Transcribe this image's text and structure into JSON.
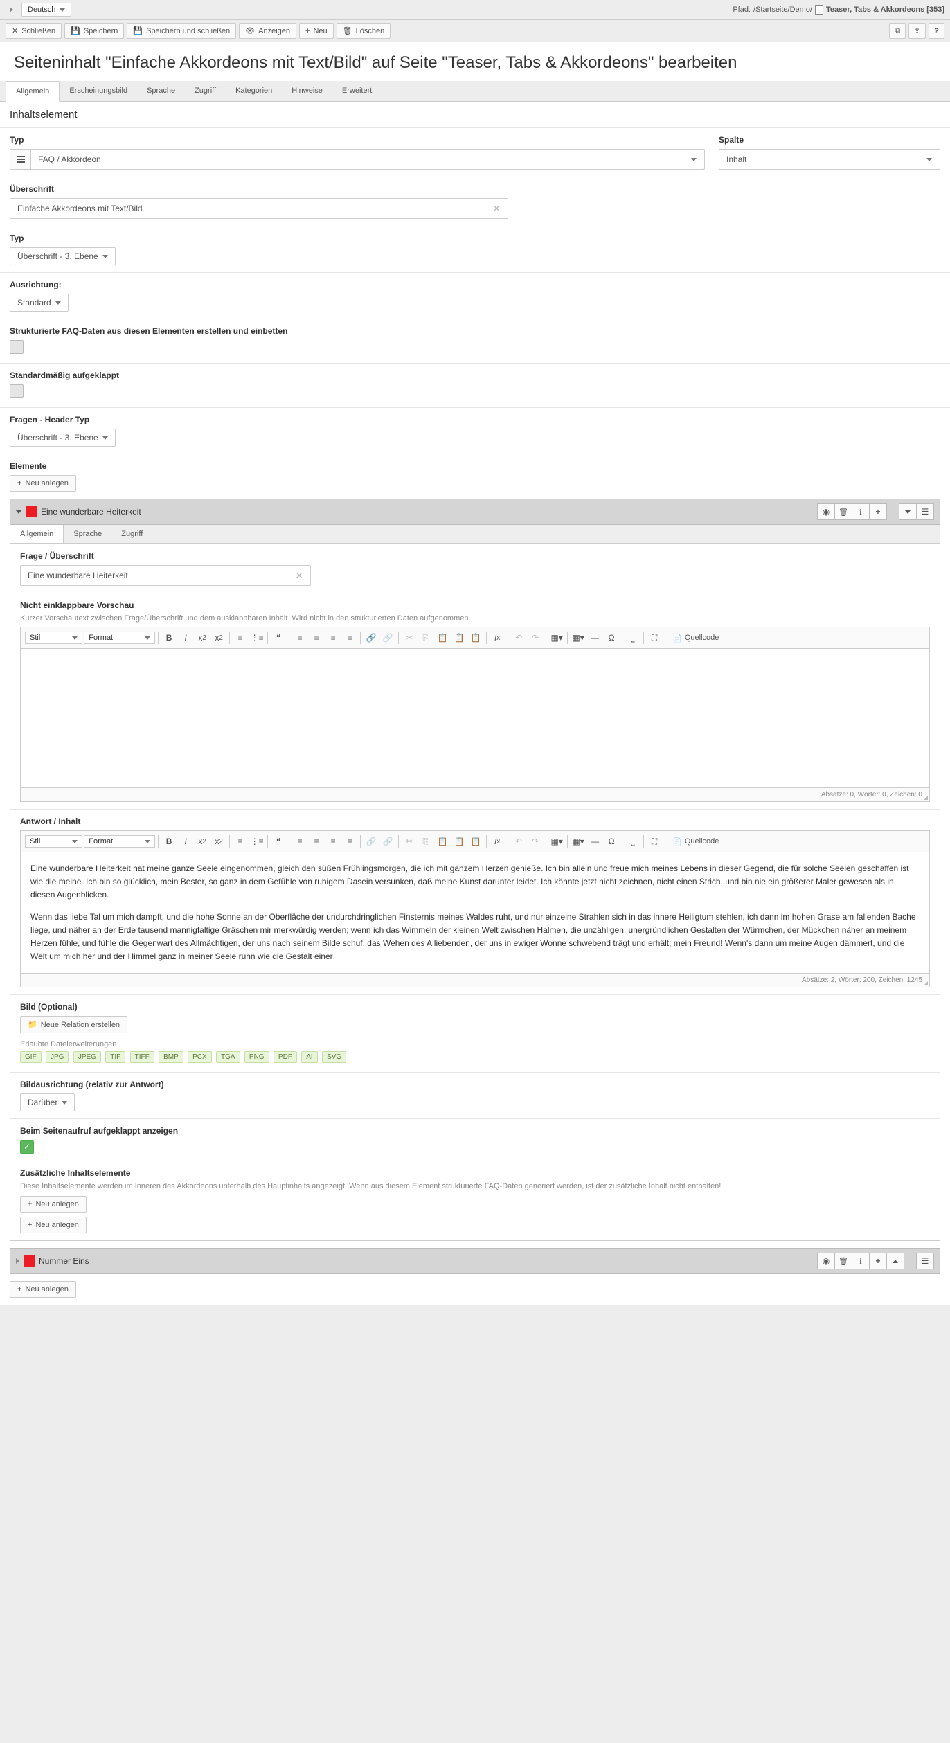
{
  "topbar": {
    "language": "Deutsch",
    "path_label": "Pfad:",
    "path_segments": "/Startseite/Demo/",
    "page_ref": "Teaser, Tabs & Akkordeons [353]"
  },
  "toolbar": {
    "close": "Schließen",
    "save": "Speichern",
    "save_close": "Speichern und schließen",
    "view": "Anzeigen",
    "new": "Neu",
    "delete": "Löschen"
  },
  "page_title": "Seiteninhalt \"Einfache Akkordeons mit Text/Bild\" auf Seite \"Teaser, Tabs & Akkordeons\" bearbeiten",
  "tabs": [
    "Allgemein",
    "Erscheinungsbild",
    "Sprache",
    "Zugriff",
    "Kategorien",
    "Hinweise",
    "Erweitert"
  ],
  "section_title": "Inhaltselement",
  "fields": {
    "type_label": "Typ",
    "type_value": "FAQ / Akkordeon",
    "column_label": "Spalte",
    "column_value": "Inhalt",
    "heading_label": "Überschrift",
    "heading_value": "Einfache Akkordeons mit Text/Bild",
    "heading_type_label": "Typ",
    "heading_type_value": "Überschrift - 3. Ebene",
    "align_label": "Ausrichtung:",
    "align_value": "Standard",
    "faq_struct_label": "Strukturierte FAQ-Daten aus diesen Elementen erstellen und einbetten",
    "default_open_label": "Standardmäßig aufgeklappt",
    "questions_header_type_label": "Fragen - Header Typ",
    "questions_header_type_value": "Überschrift - 3. Ebene",
    "elements_label": "Elemente",
    "new_create": "Neu anlegen"
  },
  "record": {
    "title": "Eine wunderbare Heiterkeit",
    "sub_tabs": [
      "Allgemein",
      "Sprache",
      "Zugriff"
    ],
    "question_label": "Frage / Überschrift",
    "question_value": "Eine wunderbare Heiterkeit",
    "preview_label": "Nicht einklappbare Vorschau",
    "preview_hint": "Kurzer Vorschautext zwischen Frage/Überschrift und dem ausklappbaren Inhalt. Wird nicht in den strukturierten Daten aufgenommen.",
    "preview_stats": "Absätze: 0, Wörter: 0, Zeichen: 0",
    "answer_label": "Antwort / Inhalt",
    "answer_p1": "Eine wunderbare Heiterkeit hat meine ganze Seele eingenommen, gleich den süßen Frühlingsmorgen, die ich mit ganzem Herzen genieße. Ich bin allein und freue mich meines Lebens in dieser Gegend, die für solche Seelen geschaffen ist wie die meine. Ich bin so glücklich, mein Bester, so ganz in dem Gefühle von ruhigem Dasein versunken, daß meine Kunst darunter leidet. Ich könnte jetzt nicht zeichnen, nicht einen Strich, und bin nie ein größerer Maler gewesen als in diesen Augenblicken.",
    "answer_p2": "Wenn das liebe Tal um mich dampft, und die hohe Sonne an der Oberfläche der undurchdringlichen Finsternis meines Waldes ruht, und nur einzelne Strahlen sich in das innere Heiligtum stehlen, ich dann im hohen Grase am fallenden Bache liege, und näher an der Erde tausend mannigfaltige Gräschen mir merkwürdig werden; wenn ich das Wimmeln der kleinen Welt zwischen Halmen, die unzähligen, unergründlichen Gestalten der Würmchen, der Mückchen näher an meinem Herzen fühle, und fühle die Gegenwart des Allmächtigen, der uns nach seinem Bilde schuf, das Wehen des Alliebenden, der uns in ewiger Wonne schwebend trägt und erhält; mein Freund! Wenn's dann um meine Augen dämmert, und die Welt um mich her und der Himmel ganz in meiner Seele ruhn wie die Gestalt einer",
    "answer_stats": "Absätze: 2, Wörter: 200, Zeichen: 1245",
    "image_label": "Bild (Optional)",
    "new_relation": "Neue Relation erstellen",
    "allowed_ext_label": "Erlaubte Dateierweiterungen",
    "allowed_ext": [
      "GIF",
      "JPG",
      "JPEG",
      "TIF",
      "TIFF",
      "BMP",
      "PCX",
      "TGA",
      "PNG",
      "PDF",
      "AI",
      "SVG"
    ],
    "image_align_label": "Bildausrichtung (relativ zur Antwort)",
    "image_align_value": "Darüber",
    "open_on_load_label": "Beim Seitenaufruf aufgeklappt anzeigen",
    "additional_label": "Zusätzliche Inhaltselemente",
    "additional_hint": "Diese Inhaltselemente werden im Inneren des Akkordeons unterhalb des Hauptinhalts angezeigt. Wenn aus diesem Element strukturierte FAQ-Daten generiert werden, ist der zusätzliche Inhalt nicht enthalten!"
  },
  "rte": {
    "style": "Stil",
    "format": "Format",
    "source": "Quellcode"
  },
  "record2": {
    "title": "Nummer Eins"
  }
}
